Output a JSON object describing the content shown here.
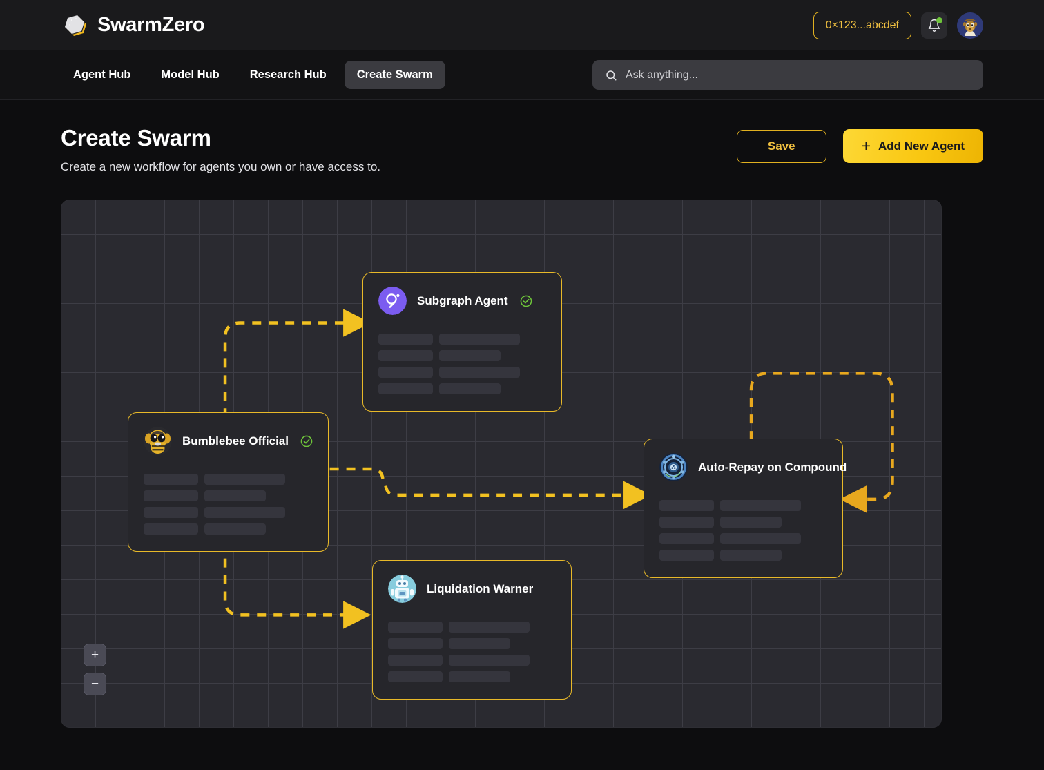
{
  "brand": {
    "name": "SwarmZero",
    "logo_icon": "hexagon-logo-icon"
  },
  "topbar": {
    "wallet_label": "0×123...abcdef",
    "notifications_icon": "bell-icon",
    "notification_badge": "unread-dot",
    "avatar_icon": "user-avatar"
  },
  "nav": {
    "items": [
      {
        "label": "Agent Hub",
        "active": false
      },
      {
        "label": "Model Hub",
        "active": false
      },
      {
        "label": "Research Hub",
        "active": false
      },
      {
        "label": "Create Swarm",
        "active": true
      }
    ]
  },
  "search": {
    "placeholder": "Ask anything...",
    "value": "",
    "icon": "search-icon"
  },
  "page": {
    "title": "Create Swarm",
    "subtitle": "Create a new workflow for agents you own or have access to.",
    "save_label": "Save",
    "add_agent_label": "Add New Agent",
    "add_agent_icon": "plus-icon"
  },
  "canvas": {
    "zoom_in_label": "+",
    "zoom_out_label": "−",
    "grid": true,
    "nodes": [
      {
        "id": "subgraph-agent",
        "title": "Subgraph Agent",
        "verified": true,
        "avatar_icon": "graph-protocol-icon",
        "avatar_color": "#7b5cf0"
      },
      {
        "id": "bumblebee-official",
        "title": "Bumblebee Official",
        "verified": true,
        "avatar_icon": "bee-robot-icon",
        "avatar_color": "#e6b32a"
      },
      {
        "id": "auto-repay-on-compound",
        "title": "Auto-Repay on Compound",
        "verified": false,
        "avatar_icon": "compound-tech-icon",
        "avatar_color": "#3f74b5"
      },
      {
        "id": "liquidation-warner",
        "title": "Liquidation Warner",
        "verified": false,
        "avatar_icon": "warning-robot-icon",
        "avatar_color": "#87ccdd"
      }
    ],
    "edges": [
      {
        "from": "bumblebee-official",
        "to": "subgraph-agent"
      },
      {
        "from": "bumblebee-official",
        "to": "auto-repay-on-compound"
      },
      {
        "from": "bumblebee-official",
        "to": "liquidation-warner"
      },
      {
        "from": "auto-repay-on-compound",
        "to": "auto-repay-on-compound"
      }
    ]
  },
  "colors": {
    "accent": "#f0c040",
    "edge": "#f2c121",
    "node_border": "#e8b929",
    "verified": "#6ec43a",
    "page_bg": "#0d0d0f",
    "canvas_bg": "#2a2a30"
  }
}
